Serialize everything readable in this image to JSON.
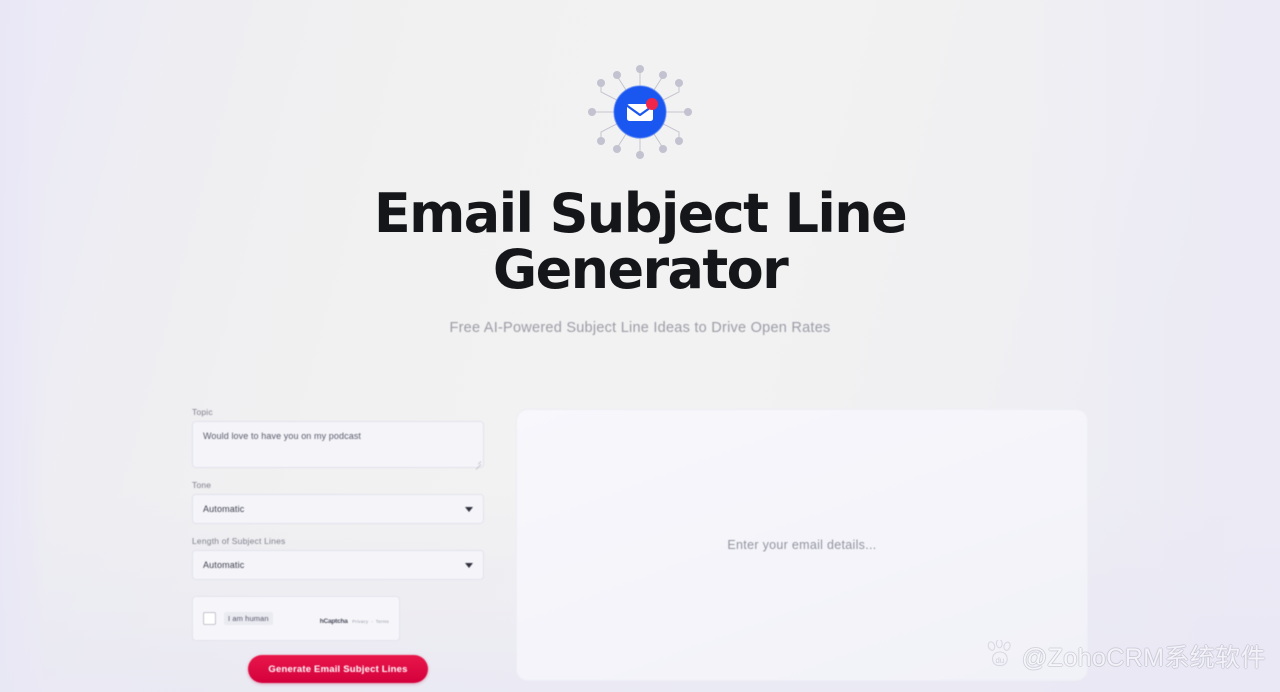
{
  "hero": {
    "icon_name": "email-network-icon",
    "title": "Email Subject Line Generator",
    "subtitle": "Free AI-Powered Subject Line Ideas to Drive Open Rates",
    "icon_colors": {
      "circle": "#1a56f0",
      "envelope": "#ffffff",
      "badge": "#f0254a",
      "node": "#b9b9c6"
    }
  },
  "form": {
    "topic": {
      "label": "Topic",
      "value": "Would love to have you on my podcast",
      "placeholder": "Would love to have you on my podcast"
    },
    "tone": {
      "label": "Tone",
      "value": "Automatic",
      "options": [
        "Automatic"
      ]
    },
    "length": {
      "label": "Length of Subject Lines",
      "value": "Automatic",
      "options": [
        "Automatic"
      ]
    },
    "captcha": {
      "label": "I am human",
      "brand": "hCaptcha",
      "privacy_label": "Privacy",
      "terms_label": "Terms",
      "checked": false
    },
    "submit_label": "Generate Email Subject Lines",
    "submit_color": "#d4003c"
  },
  "results": {
    "placeholder": "Enter your email details..."
  },
  "watermark": {
    "logo_name": "baidu-paw-icon",
    "logo_text": "du",
    "text": "@ZohoCRM系统软件"
  }
}
